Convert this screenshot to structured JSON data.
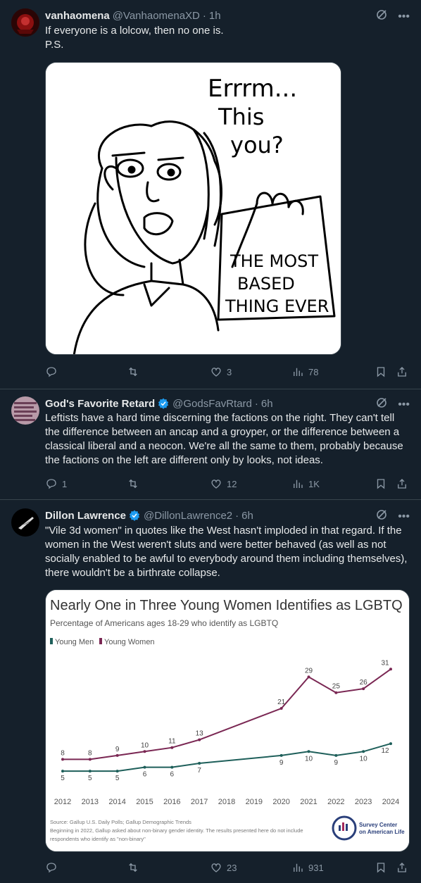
{
  "tweets": [
    {
      "name": "vanhaomena",
      "handle": "@VanhaomenaXD",
      "time": "1h",
      "text": "If everyone is a lolcow, then no one is.\nP.S.",
      "image": {
        "speech": [
          "Errrm...",
          "This",
          "you?"
        ],
        "sign": [
          "THE MOST",
          "BASED",
          "THING EVER"
        ]
      },
      "replies": "",
      "retweets": "",
      "likes": "3",
      "views": "78"
    },
    {
      "name": "God's Favorite Retard",
      "handle": "@GodsFavRtard",
      "time": "6h",
      "verified": true,
      "text": "Leftists have a hard time discerning the factions on the right. They can't tell the difference between an ancap and a groyper, or the difference between a classical liberal and a neocon. We're all the same to them, probably because the factions on the left are different only by looks, not ideas.",
      "replies": "1",
      "retweets": "",
      "likes": "12",
      "views": "1K"
    },
    {
      "name": "Dillon Lawrence",
      "handle": "@DillonLawrence2",
      "time": "6h",
      "verified": true,
      "text": "\"Vile 3d women\" in quotes like the West hasn't imploded in that regard. If the women in the West weren't sluts and were better behaved (as well as not socially enabled to be awful to everybody around them including themselves), there wouldn't be a birthrate collapse.",
      "replies": "",
      "retweets": "",
      "likes": "23",
      "views": "931"
    }
  ],
  "chart_data": {
    "type": "line",
    "title": "Nearly One in Three Young Women Identifies as LGBTQ",
    "subtitle": "Percentage of Americans ages 18-29 who identify as LGBTQ",
    "categories": [
      "2012",
      "2013",
      "2014",
      "2015",
      "2016",
      "2017",
      "2018",
      "2019",
      "2020",
      "2021",
      "2022",
      "2023",
      "2024"
    ],
    "series": [
      {
        "name": "Young Men",
        "color": "#1e5f5a",
        "values": [
          5,
          5,
          5,
          6,
          6,
          7,
          null,
          null,
          9,
          10,
          9,
          10,
          12
        ],
        "labels": [
          5,
          5,
          5,
          6,
          6,
          7,
          null,
          null,
          9,
          10,
          9,
          10,
          12
        ]
      },
      {
        "name": "Young Women",
        "color": "#7a2753",
        "values": [
          8,
          8,
          9,
          10,
          11,
          13,
          null,
          null,
          21,
          29,
          25,
          26,
          31
        ],
        "labels": [
          8,
          8,
          9,
          10,
          11,
          13,
          null,
          null,
          21,
          29,
          25,
          26,
          31
        ]
      }
    ],
    "source_line1": "Source: Gallup U.S. Daily Polls; Gallup Demographic Trends",
    "source_line2": "Beginning in 2022, Gallup asked about non-binary gender identity. The results presented here do not include",
    "source_line3": "respondents who identify as \"non-binary\"",
    "logo_text1": "Survey Center",
    "logo_text2": "on American Life",
    "ylim": [
      0,
      35
    ]
  }
}
